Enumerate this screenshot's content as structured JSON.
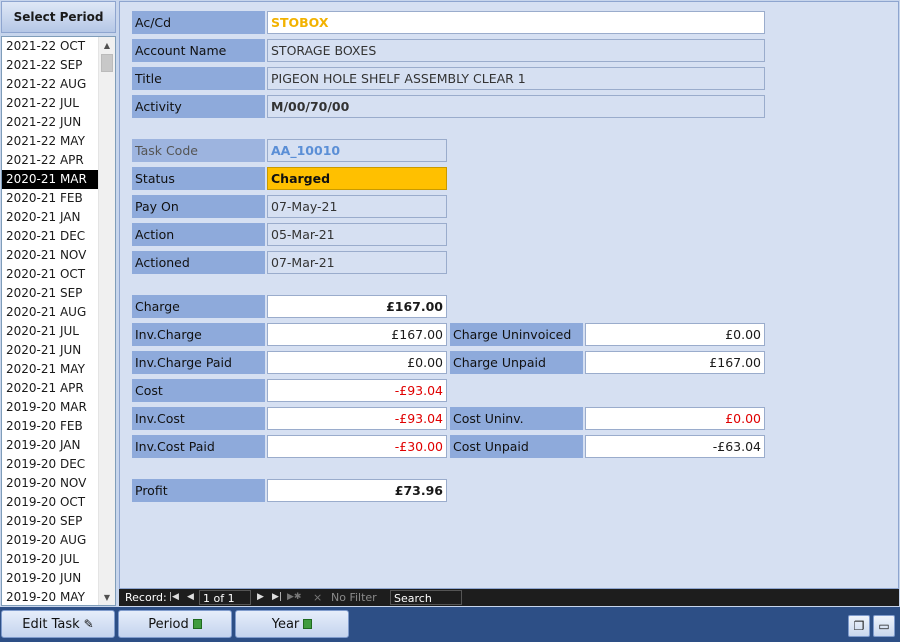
{
  "period_panel": {
    "header": "Select Period",
    "items": [
      "2021-22 OCT",
      "2021-22 SEP",
      "2021-22 AUG",
      "2021-22 JUL",
      "2021-22 JUN",
      "2021-22 MAY",
      "2021-22 APR",
      "2020-21 MAR",
      "2020-21 FEB",
      "2020-21 JAN",
      "2020-21 DEC",
      "2020-21 NOV",
      "2020-21 OCT",
      "2020-21 SEP",
      "2020-21 AUG",
      "2020-21 JUL",
      "2020-21 JUN",
      "2020-21 MAY",
      "2020-21 APR",
      "2019-20 MAR",
      "2019-20 FEB",
      "2019-20 JAN",
      "2019-20 DEC",
      "2019-20 NOV",
      "2019-20 OCT",
      "2019-20 SEP",
      "2019-20 AUG",
      "2019-20 JUL",
      "2019-20 JUN",
      "2019-20 MAY"
    ],
    "selected": "2020-21 MAR"
  },
  "form": {
    "acc_label": "Ac/Cd",
    "acc_value": "STOBOX",
    "account_name_label": "Account Name",
    "account_name_value": "STORAGE BOXES",
    "title_label": "Title",
    "title_value": "PIGEON HOLE SHELF ASSEMBLY CLEAR 1",
    "activity_label": "Activity",
    "activity_value": "M/00/70/00",
    "task_code_label": "Task Code",
    "task_code_value": "AA_10010",
    "status_label": "Status",
    "status_value": "Charged",
    "pay_on_label": "Pay On",
    "pay_on_value": "07-May-21",
    "action_label": "Action",
    "action_value": "05-Mar-21",
    "actioned_label": "Actioned",
    "actioned_value": "07-Mar-21",
    "charge_label": "Charge",
    "charge_value": "£167.00",
    "inv_charge_label": "Inv.Charge",
    "inv_charge_value": "£167.00",
    "charge_uninvoiced_label": "Charge Uninvoiced",
    "charge_uninvoiced_value": "£0.00",
    "inv_charge_paid_label": "Inv.Charge Paid",
    "inv_charge_paid_value": "£0.00",
    "charge_unpaid_label": "Charge Unpaid",
    "charge_unpaid_value": "£167.00",
    "cost_label": "Cost",
    "cost_value": "-£93.04",
    "inv_cost_label": "Inv.Cost",
    "inv_cost_value": "-£93.04",
    "cost_uninv_label": "Cost Uninv.",
    "cost_uninv_value": "£0.00",
    "inv_cost_paid_label": "Inv.Cost Paid",
    "inv_cost_paid_value": "-£30.00",
    "cost_unpaid_label": "Cost Unpaid",
    "cost_unpaid_value": "-£63.04",
    "profit_label": "Profit",
    "profit_value": "£73.96"
  },
  "nav": {
    "record_label": "Record:",
    "counter": "1 of 1",
    "filter_label": "No Filter",
    "search_placeholder": "Search",
    "first_icon": "first-record-icon",
    "prev_icon": "previous-record-icon",
    "next_icon": "next-record-icon",
    "last_icon": "last-record-icon",
    "new_icon": "new-record-icon",
    "filter_icon": "filter-icon"
  },
  "toolbar": {
    "edit_task_label": "Edit Task",
    "period_label": "Period",
    "year_label": "Year",
    "edit_icon": "pencil-icon",
    "period_icon": "green-sheet-icon",
    "year_icon": "green-sheet-icon",
    "copy_icon": "copy-icon",
    "open_icon": "folder-icon"
  },
  "colors": {
    "label_bg": "#8eaadb",
    "form_bg": "#d6e0f2",
    "status_bg": "#ffc000",
    "acc_text": "#f2b200",
    "negative_text": "#e00000",
    "toolbar_bg": "#2d4f86"
  }
}
